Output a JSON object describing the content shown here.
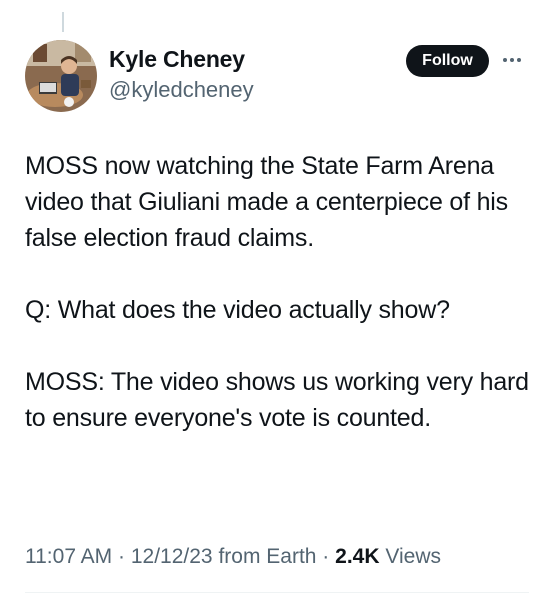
{
  "author": {
    "name": "Kyle Cheney",
    "handle": "@kyledcheney"
  },
  "actions": {
    "follow_label": "Follow"
  },
  "tweet": {
    "paragraphs": [
      "MOSS now watching the State Farm Arena video that Giuliani made a centerpiece of his false election fraud claims.",
      "Q: What does the video actually show?",
      "MOSS: The video shows us working very hard to ensure everyone's vote is counted."
    ]
  },
  "meta": {
    "time": "11:07 AM",
    "separator": " · ",
    "date": "12/12/23",
    "source": "from Earth",
    "views_count": "2.4K",
    "views_label": "Views"
  },
  "icons": {
    "avatar": "avatar-photo",
    "more": "more-horizontal-icon"
  },
  "colors": {
    "text": "#0f1419",
    "secondary": "#536471",
    "button": "#0f1419"
  }
}
